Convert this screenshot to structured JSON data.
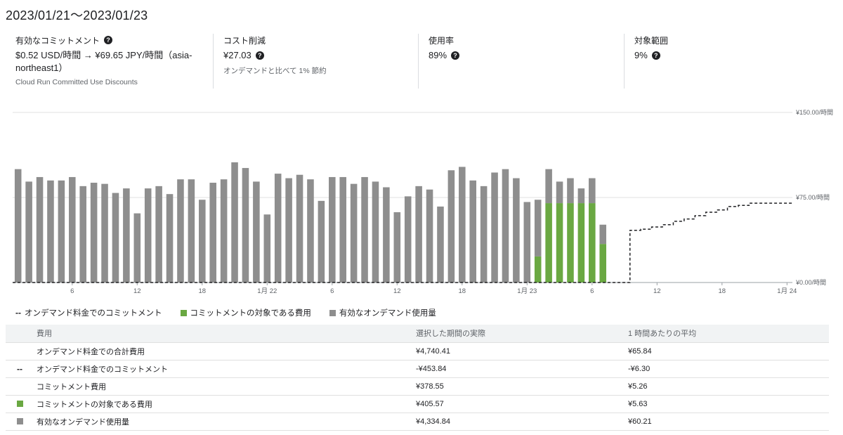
{
  "header": {
    "date_range": "2023/01/21〜2023/01/23"
  },
  "summary": {
    "commitment": {
      "title": "有効なコミットメント",
      "value": "$0.52 USD/時間 → ¥69.65 JPY/時間（asia-northeast1）",
      "sub": "Cloud Run Committed Use Discounts"
    },
    "savings": {
      "title": "コスト削減",
      "value": "¥27.03",
      "sub": "オンデマンドと比べて 1% 節約"
    },
    "utilization": {
      "title": "使用率",
      "value": "89%"
    },
    "coverage": {
      "title": "対象範囲",
      "value": "9%"
    }
  },
  "colors": {
    "green": "#6aa842",
    "gray": "#8e8e8e",
    "grid": "#e0e0e0",
    "axis": "#5f6368"
  },
  "chart_data": {
    "type": "bar",
    "x_start": "2023-01-21 01:00",
    "x_end": "2023-01-24 00:00",
    "x_step_hours": 1,
    "x_ticks": [
      "6",
      "12",
      "18",
      "1月 22",
      "6",
      "12",
      "18",
      "1月 23",
      "6",
      "12",
      "18",
      "1月 24"
    ],
    "y_ticks": [
      "¥0.00/時間",
      "¥75.00/時間",
      "¥150.00/時間"
    ],
    "ylim": [
      0,
      150
    ],
    "series": [
      {
        "name": "有効なオンデマンド使用量",
        "color": "#8e8e8e",
        "values": [
          100,
          89,
          93,
          90,
          90,
          93,
          85,
          88,
          87,
          79,
          83,
          61,
          83,
          85,
          78,
          91,
          91,
          73,
          88,
          91,
          106,
          101,
          89,
          60,
          96,
          92,
          95,
          91,
          72,
          93,
          93,
          87,
          93,
          89,
          84,
          62,
          76,
          85,
          82,
          67,
          99,
          102,
          90,
          85,
          97,
          100,
          92,
          71,
          50,
          30,
          19,
          22,
          13,
          22,
          17
        ]
      },
      {
        "name": "コミットメントの対象である費用",
        "color": "#6aa842",
        "values": [
          0,
          0,
          0,
          0,
          0,
          0,
          0,
          0,
          0,
          0,
          0,
          0,
          0,
          0,
          0,
          0,
          0,
          0,
          0,
          0,
          0,
          0,
          0,
          0,
          0,
          0,
          0,
          0,
          0,
          0,
          0,
          0,
          0,
          0,
          0,
          0,
          0,
          0,
          0,
          0,
          0,
          0,
          0,
          0,
          0,
          0,
          0,
          0,
          23,
          70,
          70,
          70,
          70,
          70,
          34
        ]
      },
      {
        "name": "オンデマンド料金でのコミットメント",
        "style": "dashed",
        "points": [
          [
            0,
            0
          ],
          [
            56,
            0
          ],
          [
            57,
            46
          ],
          [
            58,
            47
          ],
          [
            59,
            49
          ],
          [
            60,
            51
          ],
          [
            61,
            54
          ],
          [
            62,
            56
          ],
          [
            63,
            59
          ],
          [
            64,
            62
          ],
          [
            65,
            64
          ],
          [
            66,
            67
          ],
          [
            67,
            68
          ],
          [
            68,
            70
          ],
          [
            69,
            70
          ],
          [
            70,
            70
          ],
          [
            71,
            70
          ],
          [
            72,
            70
          ]
        ]
      }
    ]
  },
  "legend": [
    {
      "label": "オンデマンド料金でのコミットメント"
    },
    {
      "label": "コミットメントの対象である費用"
    },
    {
      "label": "有効なオンデマンド使用量"
    }
  ],
  "table": {
    "headers": {
      "name": "費用",
      "actual": "選択した期間の実際",
      "avg": "1 時間あたりの平均"
    },
    "rows": [
      {
        "name": "オンデマンド料金での合計費用",
        "actual": "¥4,740.41",
        "avg": "¥65.84"
      },
      {
        "name": "オンデマンド料金でのコミットメント",
        "actual": "-¥453.84",
        "avg": "-¥6.30"
      },
      {
        "name": "コミットメント費用",
        "actual": "¥378.55",
        "avg": "¥5.26"
      },
      {
        "name": "コミットメントの対象である費用",
        "actual": "¥405.57",
        "avg": "¥5.63"
      },
      {
        "name": "有効なオンデマンド使用量",
        "actual": "¥4,334.84",
        "avg": "¥60.21"
      }
    ]
  }
}
